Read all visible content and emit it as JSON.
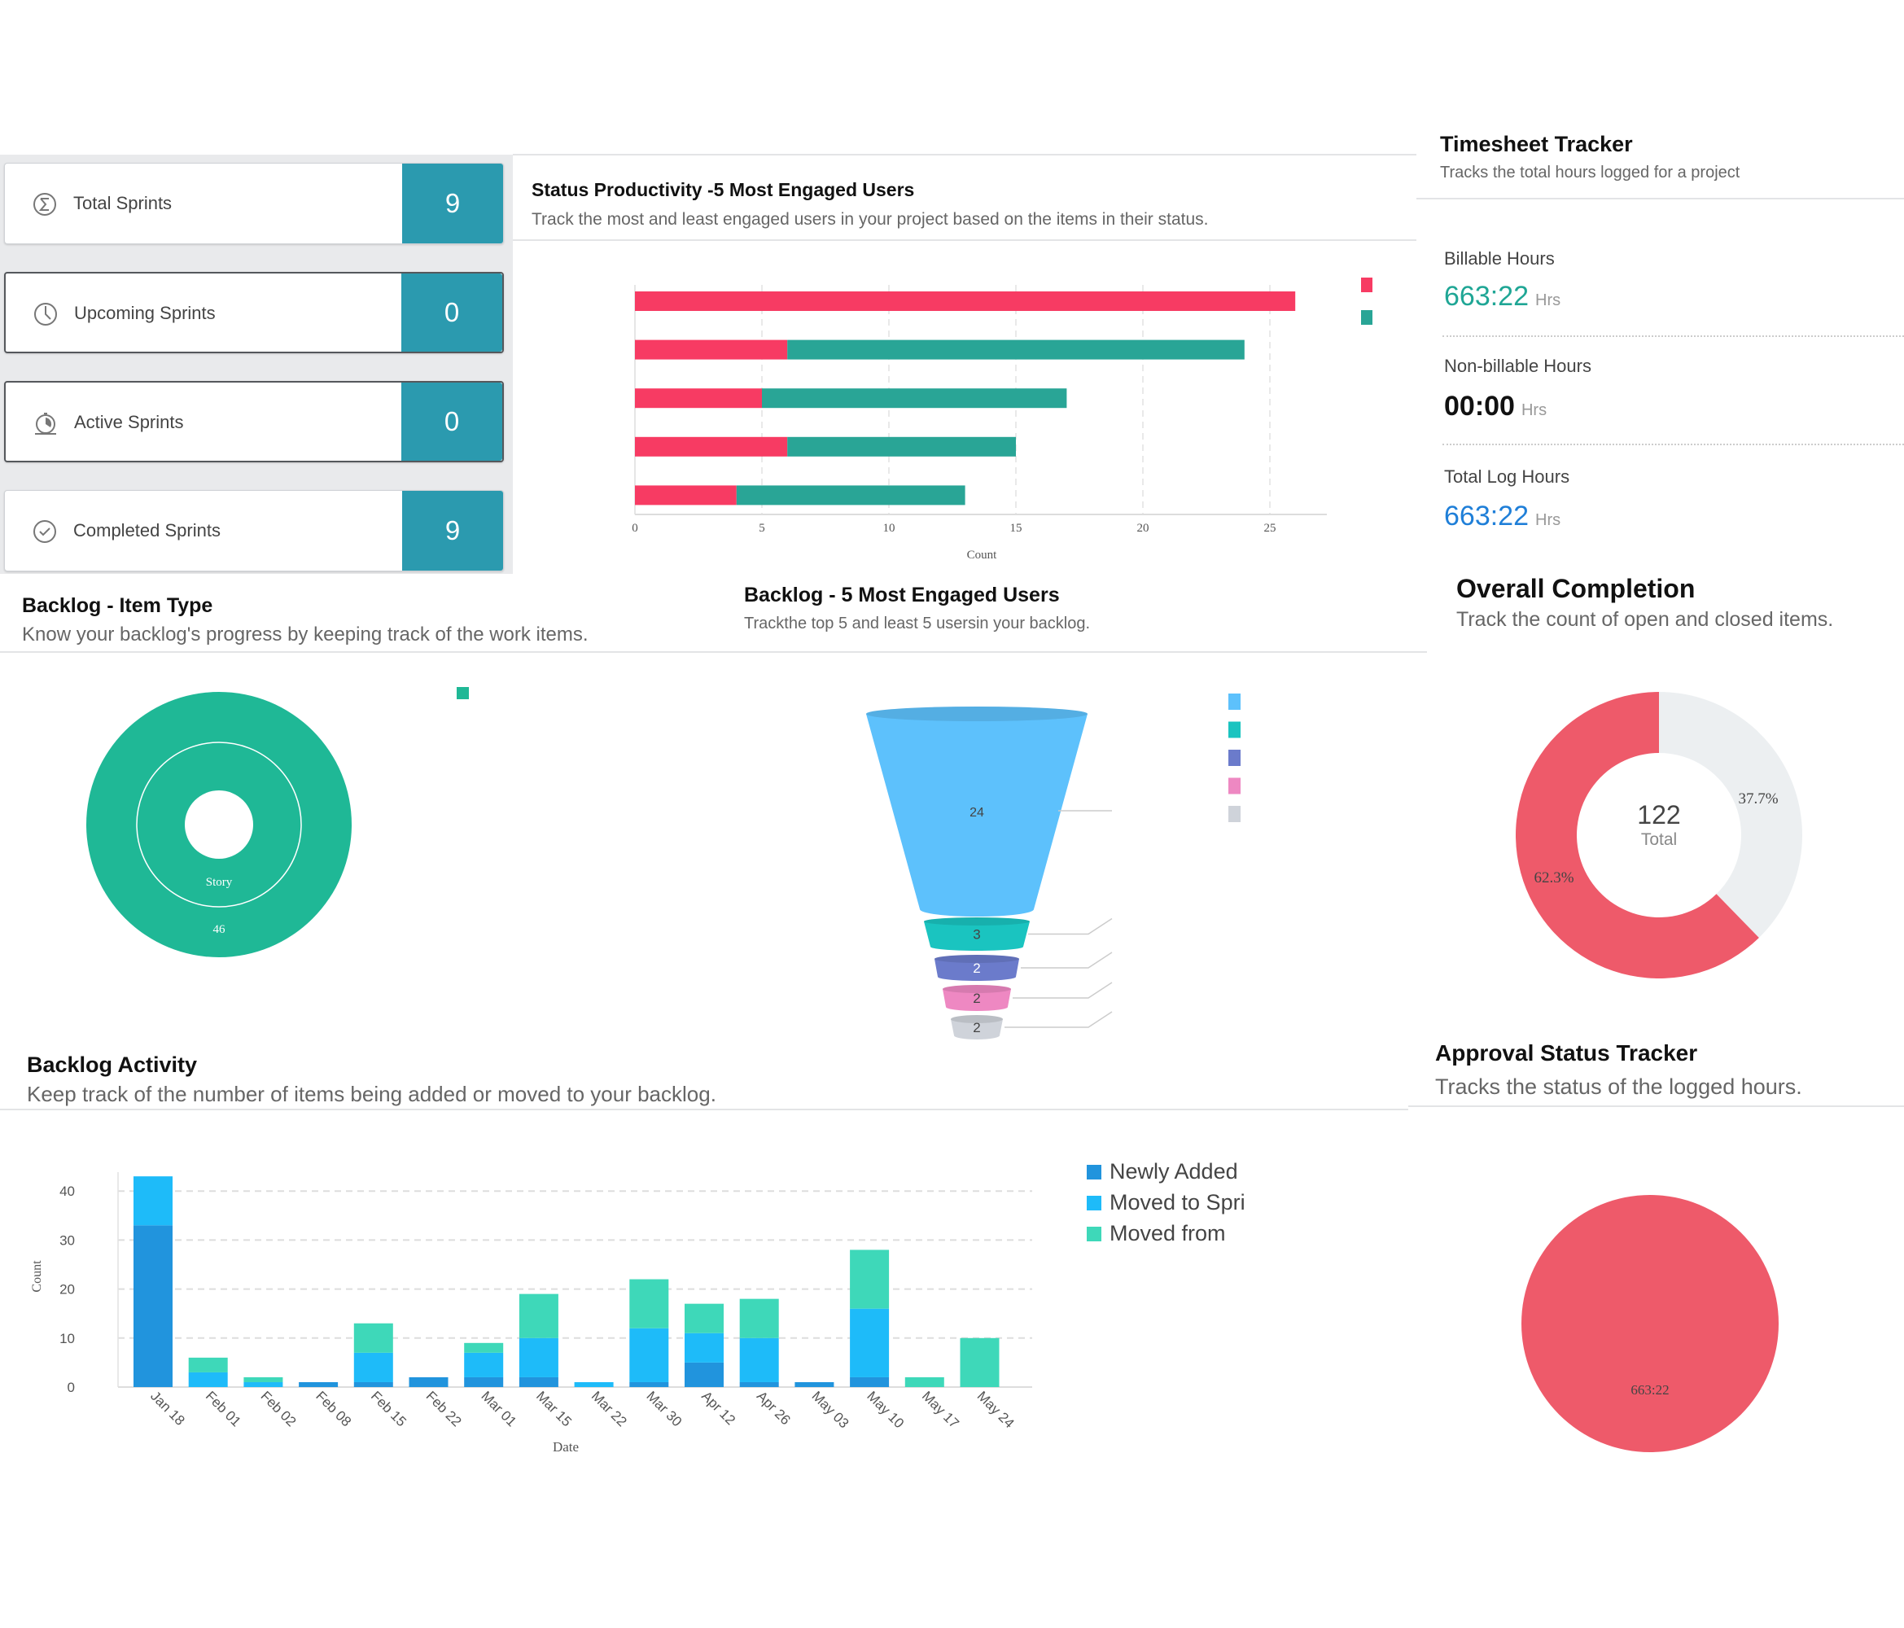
{
  "sprints": [
    {
      "label": "Total Sprints",
      "value": "9",
      "icon": "sigma-icon"
    },
    {
      "label": "Upcoming Sprints",
      "value": "0",
      "icon": "clock-icon"
    },
    {
      "label": "Active Sprints",
      "value": "0",
      "icon": "stopwatch-icon"
    },
    {
      "label": "Completed Sprints",
      "value": "9",
      "icon": "check-circle-icon"
    }
  ],
  "status_productivity": {
    "title": "Status Productivity -5 Most Engaged Users",
    "subtitle": "Track the most and least engaged users in your project based on the items in their status."
  },
  "timesheet": {
    "title": "Timesheet Tracker",
    "subtitle": "Tracks the total hours logged for a project",
    "billable_label": "Billable Hours",
    "billable_value": "663:22",
    "nonbillable_label": "Non-billable Hours",
    "nonbillable_value": "00:00",
    "total_label": "Total Log Hours",
    "total_value": "663:22",
    "unit": "Hrs",
    "colors": {
      "billable": "#1fa695",
      "nonbillable": "#111111",
      "total": "#1f7fd8"
    }
  },
  "backlog_item_type": {
    "title": "Backlog - Item Type",
    "subtitle": "Know your backlog's progress by keeping track of the work items."
  },
  "backlog_engaged": {
    "title": "Backlog - 5 Most Engaged Users",
    "subtitle": "Trackthe top 5 and least 5 usersin your backlog."
  },
  "overall_completion": {
    "title": "Overall Completion",
    "subtitle": "Track the count of open and closed items."
  },
  "backlog_activity": {
    "title": "Backlog Activity",
    "subtitle": "Keep track of the number of items being added or moved to your backlog."
  },
  "approval": {
    "title": "Approval Status Tracker",
    "subtitle": "Tracks the status of the logged hours."
  },
  "chart_data": [
    {
      "id": "status_productivity",
      "type": "bar",
      "orientation": "horizontal",
      "stacked": true,
      "xlabel": "Count",
      "xlim": [
        0,
        27
      ],
      "xticks": [
        "0",
        "5",
        "10",
        "15",
        "20",
        "25"
      ],
      "grid": true,
      "legend": "top-right",
      "series": [
        {
          "color": "#f73b63",
          "values": [
            26,
            6,
            5,
            6,
            4
          ]
        },
        {
          "color": "#29a596",
          "values": [
            0,
            18,
            12,
            9,
            9
          ]
        }
      ]
    },
    {
      "id": "backlog_item_type",
      "type": "pie",
      "donut": true,
      "categories": [
        "Story"
      ],
      "values": [
        46
      ],
      "colors": [
        "#1fb896"
      ],
      "legend": "top-right"
    },
    {
      "id": "backlog_engaged",
      "type": "funnel",
      "values": [
        24,
        3,
        2,
        2,
        2
      ],
      "colors": [
        "#5dc1fc",
        "#1ac4c0",
        "#6b7bcb",
        "#ee88c2",
        "#cfd3da"
      ],
      "legend": "right"
    },
    {
      "id": "overall_completion",
      "type": "pie",
      "donut": true,
      "total": "122",
      "total_label": "Total",
      "slices": [
        {
          "label": "37.7%",
          "value": 37.7,
          "color": "#eceff1"
        },
        {
          "label": "62.3%",
          "value": 62.3,
          "color": "#ee5a6a"
        }
      ]
    },
    {
      "id": "backlog_activity",
      "type": "bar",
      "stacked": true,
      "xlabel": "Date",
      "ylabel": "Count",
      "ylim": [
        0,
        45
      ],
      "yticks": [
        "0",
        "10",
        "20",
        "30",
        "40"
      ],
      "grid": true,
      "legend": "right",
      "categories": [
        "Jan 18",
        "Feb 01",
        "Feb 02",
        "Feb 08",
        "Feb 15",
        "Feb 22",
        "Mar 01",
        "Mar 15",
        "Mar 22",
        "Mar 30",
        "Apr 12",
        "Apr 26",
        "May 03",
        "May 10",
        "May 17",
        "May 24"
      ],
      "series": [
        {
          "name": "Newly Added",
          "color": "#2194dd",
          "values": [
            33,
            0,
            0,
            1,
            1,
            2,
            2,
            2,
            0,
            1,
            5,
            1,
            1,
            2,
            0,
            0
          ]
        },
        {
          "name": "Moved to Spri",
          "color": "#1ebbf9",
          "values": [
            10,
            3,
            1,
            0,
            6,
            0,
            5,
            8,
            1,
            11,
            6,
            9,
            0,
            14,
            0,
            0
          ]
        },
        {
          "name": "Moved from",
          "color": "#3ed8b9",
          "values": [
            0,
            3,
            1,
            0,
            6,
            0,
            2,
            9,
            0,
            10,
            6,
            8,
            0,
            12,
            2,
            10
          ]
        }
      ]
    },
    {
      "id": "approval",
      "type": "pie",
      "slices": [
        {
          "label": "663:22",
          "value": 100,
          "color": "#ee5a6a"
        }
      ]
    }
  ]
}
